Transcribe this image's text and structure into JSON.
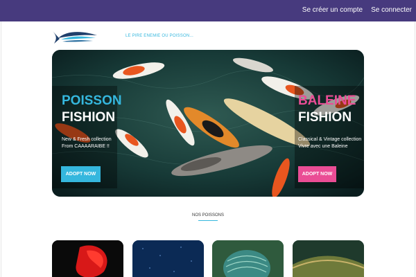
{
  "header": {
    "nav": [
      {
        "label": "Se créer un compte"
      },
      {
        "label": "Se connecter"
      }
    ]
  },
  "brand": {
    "tagline": "LE PIRE ENEMIE OU POISSON..."
  },
  "hero": {
    "left": {
      "title_line1": "POISSON",
      "title_line2": "FISHION",
      "subtitle_line1": "New & Fresh collection",
      "subtitle_line2": "From CAAAARAIBE !!",
      "button_label": "ADOPT NOW"
    },
    "right": {
      "title_line1": "BALEINE",
      "title_line2": "FISHION",
      "subtitle_line1": "Classical & Vintage collection",
      "subtitle_line2": "Vivre avec une Baleine",
      "button_label": "ADOPT NOW"
    }
  },
  "section": {
    "title": "NOS POISSONS"
  },
  "products": [
    {
      "icon": "betta-fish-image"
    },
    {
      "icon": "blue-fish-image"
    },
    {
      "icon": "discus-fish-image"
    },
    {
      "icon": "green-fish-image"
    }
  ],
  "colors": {
    "topbar": "#473a7e",
    "accent_blue": "#35b7de",
    "accent_pink": "#ea4d95"
  }
}
